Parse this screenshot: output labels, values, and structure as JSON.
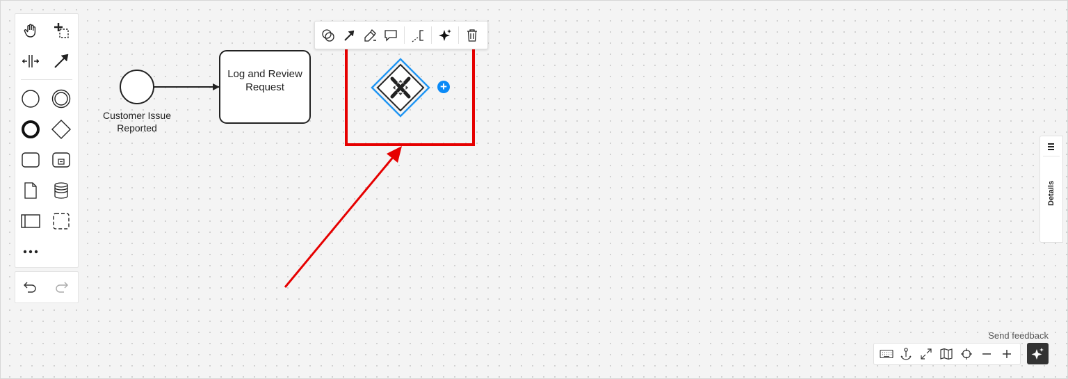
{
  "palette": {
    "tools": [
      {
        "name": "hand-tool-icon"
      },
      {
        "name": "lasso-tool-icon"
      },
      {
        "name": "space-tool-icon"
      },
      {
        "name": "global-connect-tool-icon"
      },
      {
        "name": "start-event-icon"
      },
      {
        "name": "intermediate-event-icon"
      },
      {
        "name": "end-event-icon"
      },
      {
        "name": "gateway-icon"
      },
      {
        "name": "task-icon"
      },
      {
        "name": "subprocess-icon"
      },
      {
        "name": "data-object-icon"
      },
      {
        "name": "data-store-icon"
      },
      {
        "name": "pool-icon"
      },
      {
        "name": "group-icon"
      },
      {
        "name": "more-tools-icon"
      }
    ],
    "undo_icon": "undo-icon",
    "redo_icon": "redo-icon"
  },
  "diagram": {
    "start_event_label": "Customer Issue Reported",
    "task_label": "Log and Review Request",
    "gateway": "exclusive-gateway"
  },
  "context_pad": {
    "items": [
      "change-type-icon",
      "connect-icon",
      "color-icon",
      "comment-icon",
      "text-annotation-icon",
      "ai-sparkle-icon",
      "delete-icon"
    ]
  },
  "details_panel": {
    "label": "Details"
  },
  "footer": {
    "feedback": "Send feedback",
    "controls": [
      "keyboard-icon",
      "anchor-icon",
      "fullscreen-icon",
      "minimap-icon",
      "reset-view-icon",
      "zoom-out-icon",
      "zoom-in-icon"
    ]
  },
  "colors": {
    "selection": "#2196f3",
    "append": "#0a8af7",
    "annotation": "#e60000",
    "shape_stroke": "#222222"
  }
}
